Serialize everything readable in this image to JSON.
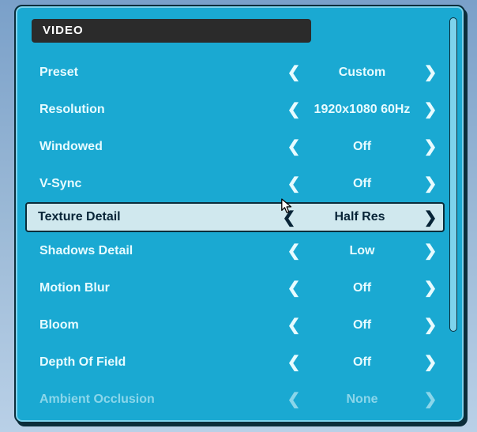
{
  "header": {
    "title": "VIDEO"
  },
  "glyphs": {
    "left": "❮",
    "right": "❯"
  },
  "selectedIndex": 4,
  "rows": [
    {
      "label": "Preset",
      "value": "Custom",
      "faded": false
    },
    {
      "label": "Resolution",
      "value": "1920x1080 60Hz",
      "faded": false
    },
    {
      "label": "Windowed",
      "value": "Off",
      "faded": false
    },
    {
      "label": "V-Sync",
      "value": "Off",
      "faded": false
    },
    {
      "label": "Texture Detail",
      "value": "Half Res",
      "faded": false
    },
    {
      "label": "Shadows Detail",
      "value": "Low",
      "faded": false
    },
    {
      "label": "Motion Blur",
      "value": "Off",
      "faded": false
    },
    {
      "label": "Bloom",
      "value": "Off",
      "faded": false
    },
    {
      "label": "Depth Of Field",
      "value": "Off",
      "faded": false
    },
    {
      "label": "Ambient Occlusion",
      "value": "None",
      "faded": true
    }
  ]
}
